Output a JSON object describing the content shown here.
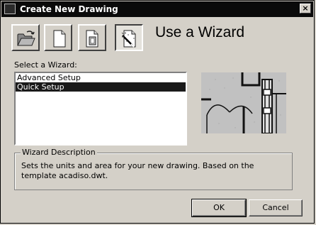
{
  "window": {
    "title": "Create New Drawing",
    "close_glyph": "×"
  },
  "toolbar": {
    "buttons": [
      {
        "icon": "open-folder-icon"
      },
      {
        "icon": "blank-page-icon"
      },
      {
        "icon": "template-page-icon"
      },
      {
        "icon": "wizard-icon",
        "pressed": true
      }
    ]
  },
  "main": {
    "heading": "Use a Wizard",
    "select_label": "Select a Wizard:",
    "wizards": [
      "Advanced Setup",
      "Quick Setup"
    ],
    "selected_index": 1
  },
  "description": {
    "legend": "Wizard Description",
    "text": "Sets the units and area for your new drawing. Based on the template acadiso.dwt."
  },
  "buttons": {
    "ok": "OK",
    "cancel": "Cancel"
  }
}
